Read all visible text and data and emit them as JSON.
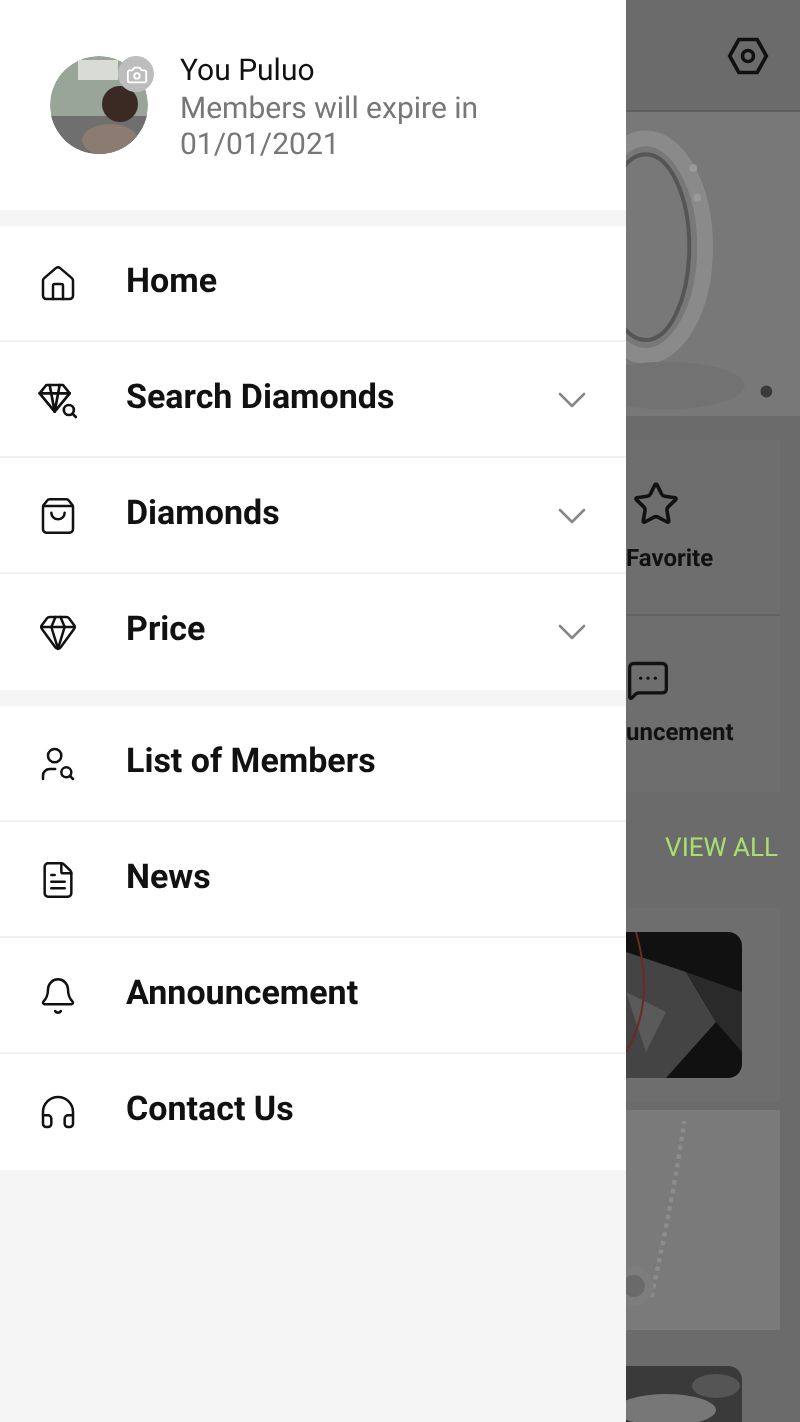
{
  "profile": {
    "name": "You Puluo",
    "membership": "Members will expire in 01/01/2021"
  },
  "menu_groups": [
    [
      {
        "label": "Home",
        "expandable": false
      },
      {
        "label": "Search Diamonds",
        "expandable": true
      },
      {
        "label": "Diamonds",
        "expandable": true
      },
      {
        "label": "Price",
        "expandable": true
      }
    ],
    [
      {
        "label": "List of Members",
        "expandable": false
      },
      {
        "label": "News",
        "expandable": false
      },
      {
        "label": "Announcement",
        "expandable": false
      },
      {
        "label": "Contact Us",
        "expandable": false
      }
    ]
  ],
  "background_page": {
    "shortcuts": [
      {
        "label": "Favorite"
      },
      {
        "label": "uncement"
      }
    ],
    "view_all": "VIEW ALL"
  }
}
